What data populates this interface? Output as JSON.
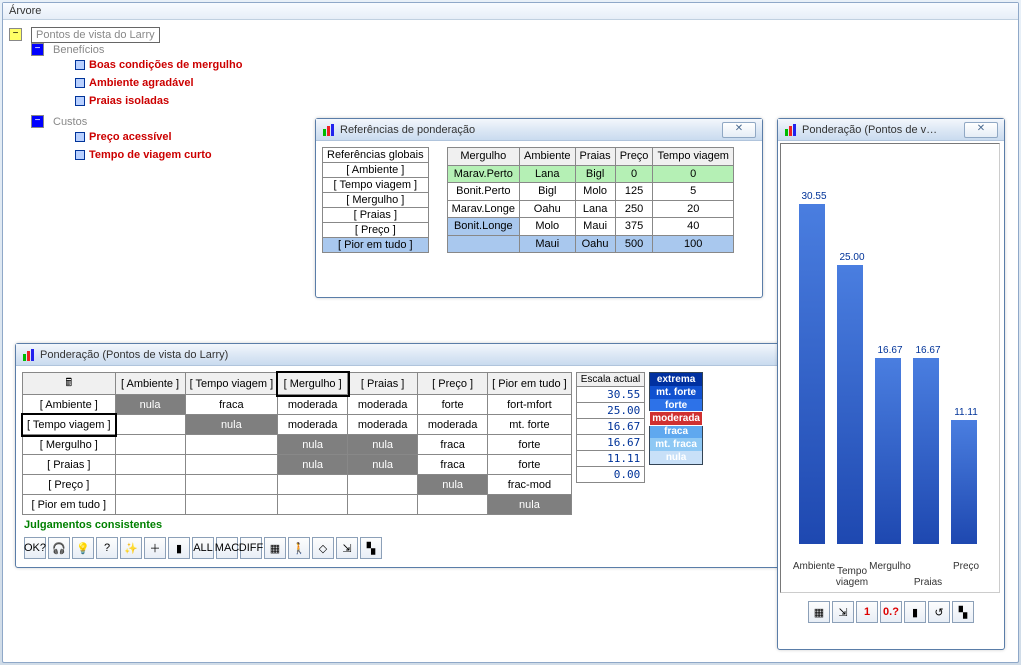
{
  "outer_title": "Árvore",
  "tree": {
    "root": "Pontos de vista do Larry",
    "benefits_label": "Benefícios",
    "benefits": [
      "Boas condições de mergulho",
      "Ambiente agradável",
      "Praias isoladas"
    ],
    "costs_label": "Custos",
    "costs": [
      "Preço acessível",
      "Tempo de viagem curto"
    ]
  },
  "refwin": {
    "title": "Referências de ponderação",
    "left_header": "Referências globais",
    "left_items": [
      "[ Ambiente ]",
      "[ Tempo viagem ]",
      "[ Mergulho ]",
      "[ Praias ]",
      "[ Preço ]",
      "[ Pior em tudo ]"
    ],
    "left_selected_index": 1,
    "cols": [
      "Mergulho",
      "Ambiente",
      "Praias",
      "Preço",
      "Tempo viagem"
    ],
    "rows": [
      {
        "label": "Marav.Perto",
        "cells": [
          "Lana",
          "Bigl",
          "0",
          "0"
        ],
        "green": true
      },
      {
        "label": "Bonit.Perto",
        "cells": [
          "Bigl",
          "Molo",
          "125",
          "5"
        ]
      },
      {
        "label": "Marav.Longe",
        "cells": [
          "Oahu",
          "Lana",
          "250",
          "20"
        ]
      },
      {
        "label": "Bonit.Longe",
        "cells": [
          "Molo",
          "Maui",
          "375",
          "40"
        ],
        "labelblue": true
      },
      {
        "label": "",
        "cells": [
          "Maui",
          "Oahu",
          "500",
          "100"
        ],
        "blue": true
      }
    ]
  },
  "matwin": {
    "title": "Ponderação (Pontos de vista do Larry)",
    "cols": [
      "[ Ambiente ]",
      "[ Tempo viagem ]",
      "[ Mergulho ]",
      "[ Praias ]",
      "[ Preço ]",
      "[ Pior em tudo ]"
    ],
    "rows": [
      {
        "h": "[ Ambiente ]",
        "c": [
          "nula",
          "fraca",
          "moderada",
          "moderada",
          "forte",
          "fort-mfort"
        ]
      },
      {
        "h": "[ Tempo viagem ]",
        "c": [
          "",
          "nula",
          "moderada",
          "moderada",
          "moderada",
          "mt. forte"
        ]
      },
      {
        "h": "[ Mergulho ]",
        "c": [
          "",
          "",
          "nula",
          "nula",
          "fraca",
          "forte"
        ]
      },
      {
        "h": "[ Praias ]",
        "c": [
          "",
          "",
          "nula",
          "nula",
          "fraca",
          "forte"
        ]
      },
      {
        "h": "[ Preço ]",
        "c": [
          "",
          "",
          "",
          "",
          "nula",
          "frac-mod"
        ]
      },
      {
        "h": "[ Pior em tudo ]",
        "c": [
          "",
          "",
          "",
          "",
          "",
          "nula"
        ]
      }
    ],
    "escala_header": "Escala actual",
    "escala": [
      "30.55",
      "25.00",
      "16.67",
      "16.67",
      "11.11",
      "0.00"
    ],
    "legend": [
      "extrema",
      "mt. forte",
      "forte",
      "moderada",
      "fraca",
      "mt. fraca",
      "nula"
    ],
    "legend_sel": "moderada",
    "status": "Julgamentos consistentes"
  },
  "chartwin_title": "Ponderação (Pontos de v…",
  "chart_data": {
    "type": "bar",
    "title": "",
    "categories": [
      "Ambiente",
      "Tempo viagem",
      "Mergulho",
      "Praias",
      "Preço"
    ],
    "values": [
      30.55,
      25.0,
      16.67,
      16.67,
      11.11
    ],
    "ylim": [
      0,
      35
    ],
    "xlabel": "",
    "ylabel": ""
  },
  "toolbar_icons": [
    "ok?-icon",
    "headset-icon",
    "bulb-off-icon",
    "bulb-question-icon",
    "bulb-on-icon",
    "plus-icon",
    "bars-icon",
    "all-icon",
    "mac-icon",
    "diff-icon",
    "grid-icon",
    "person-icon",
    "diamond-icon",
    "ladder-icon",
    "mosaic-icon"
  ],
  "chart_toolbar_icons": [
    "grid-icon",
    "ladder-icon",
    "one-icon",
    "zeroq-icon",
    "bars-icon",
    "rewind-icon",
    "mosaic-icon"
  ],
  "chart_toolbar_labels": {
    "one": "1",
    "zeroq": "0.?"
  }
}
